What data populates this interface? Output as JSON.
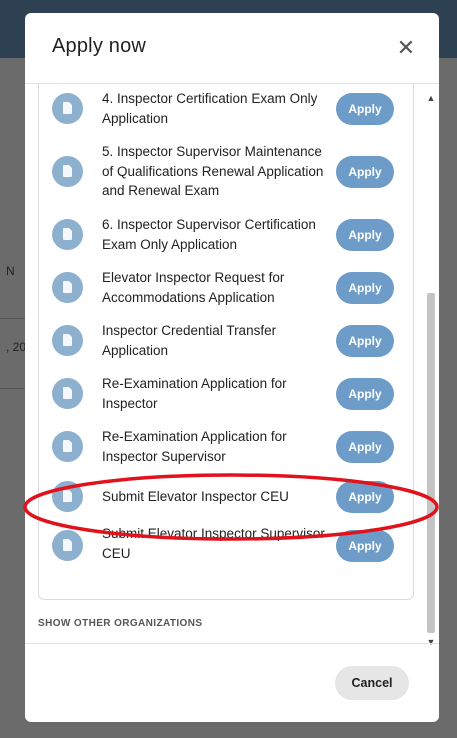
{
  "background": {
    "fragment_1": "N",
    "fragment_2": ", 20"
  },
  "modal": {
    "title": "Apply now",
    "close_symbol": "✕",
    "items": [
      {
        "label": "4. Inspector Certification Exam Only Application",
        "button": "Apply"
      },
      {
        "label": "5. Inspector Supervisor Maintenance of Qualifications Renewal Application and Renewal Exam",
        "button": "Apply"
      },
      {
        "label": "6. Inspector Supervisor Certification Exam Only Application",
        "button": "Apply"
      },
      {
        "label": "Elevator Inspector Request for Accommodations Application",
        "button": "Apply"
      },
      {
        "label": "Inspector Credential Transfer Application",
        "button": "Apply"
      },
      {
        "label": "Re-Examination Application for Inspector",
        "button": "Apply"
      },
      {
        "label": "Re-Examination Application for Inspector Supervisor",
        "button": "Apply"
      },
      {
        "label": "Submit Elevator Inspector CEU",
        "button": "Apply"
      },
      {
        "label": "Submit Elevator Inspector Supervisor CEU",
        "button": "Apply"
      }
    ],
    "show_other": "SHOW OTHER ORGANIZATIONS",
    "cancel": "Cancel"
  },
  "colors": {
    "apply_button": "#6d9cc9",
    "doc_icon": "#8eb0cf",
    "annotation": "#e0131d"
  },
  "icons": {
    "item_icon": "document-icon",
    "close": "close-icon",
    "scroll_up": "chevron-up-icon",
    "scroll_down": "chevron-down-icon"
  }
}
